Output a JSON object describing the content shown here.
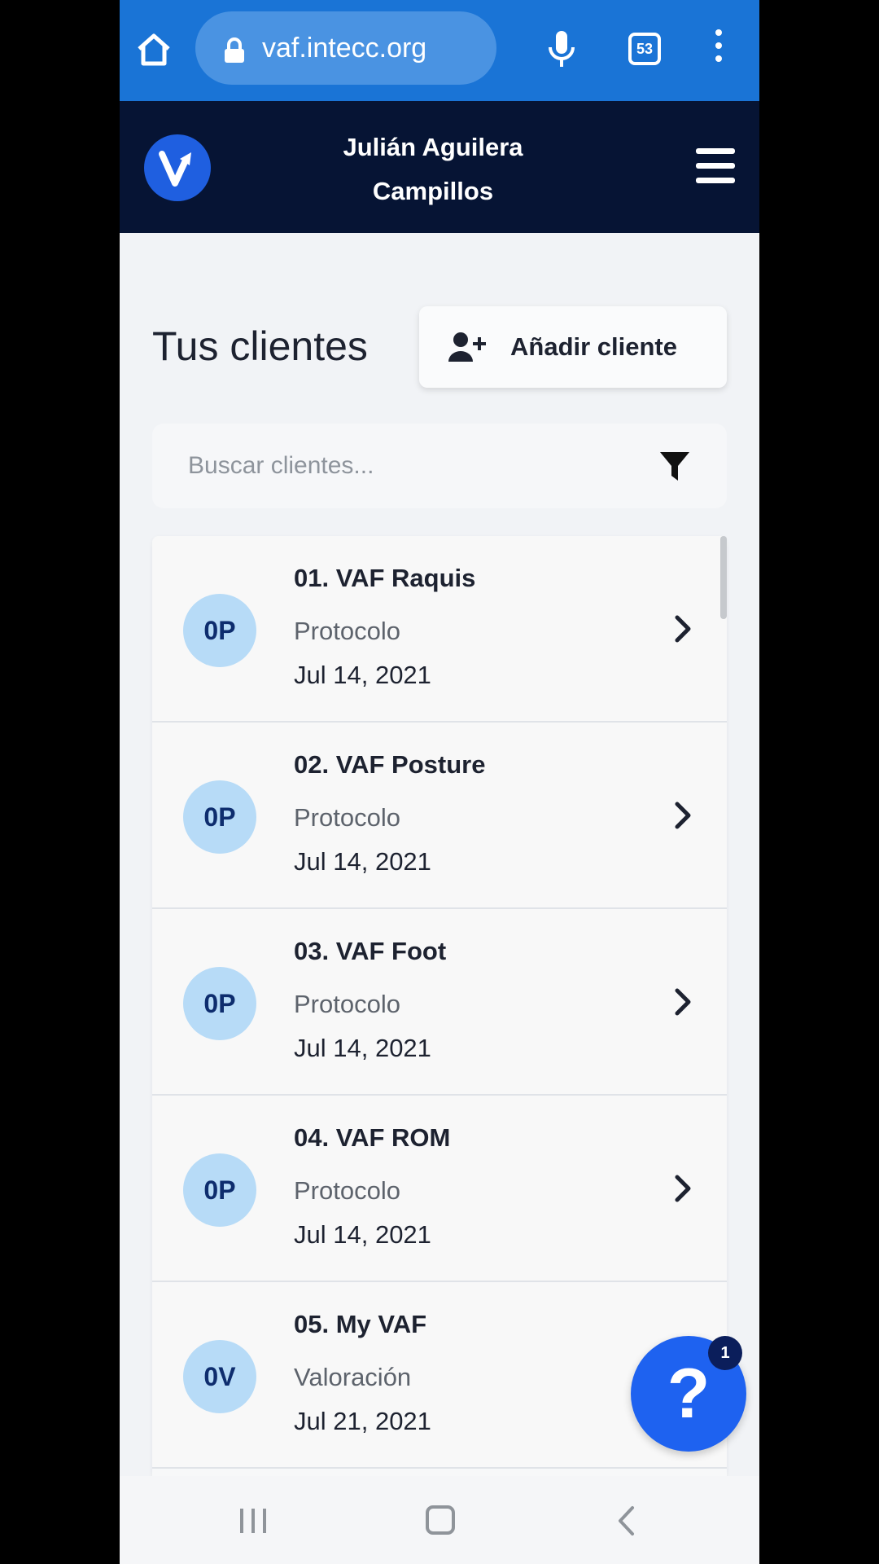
{
  "browser": {
    "url": "vaf.intecc.org",
    "tab_count": "53"
  },
  "header": {
    "user_name_line1": "Julián Aguilera",
    "user_name_line2": "Campillos"
  },
  "page": {
    "title": "Tus clientes",
    "add_client_label": "Añadir cliente"
  },
  "search": {
    "placeholder": "Buscar clientes..."
  },
  "clients": [
    {
      "initials": "0P",
      "name": "01. VAF Raquis",
      "type": "Protocolo",
      "date": "Jul 14, 2021"
    },
    {
      "initials": "0P",
      "name": "02. VAF Posture",
      "type": "Protocolo",
      "date": "Jul 14, 2021"
    },
    {
      "initials": "0P",
      "name": "03. VAF Foot",
      "type": "Protocolo",
      "date": "Jul 14, 2021"
    },
    {
      "initials": "0P",
      "name": "04. VAF ROM",
      "type": "Protocolo",
      "date": "Jul 14, 2021"
    },
    {
      "initials": "0V",
      "name": "05. My VAF",
      "type": "Valoración",
      "date": "Jul 21, 2021"
    }
  ],
  "help": {
    "symbol": "?",
    "badge_count": "1"
  },
  "colors": {
    "browser_bar": "#1a74d6",
    "app_header": "#061434",
    "avatar_bg": "#b7dbf7",
    "fab": "#1e62f0"
  }
}
